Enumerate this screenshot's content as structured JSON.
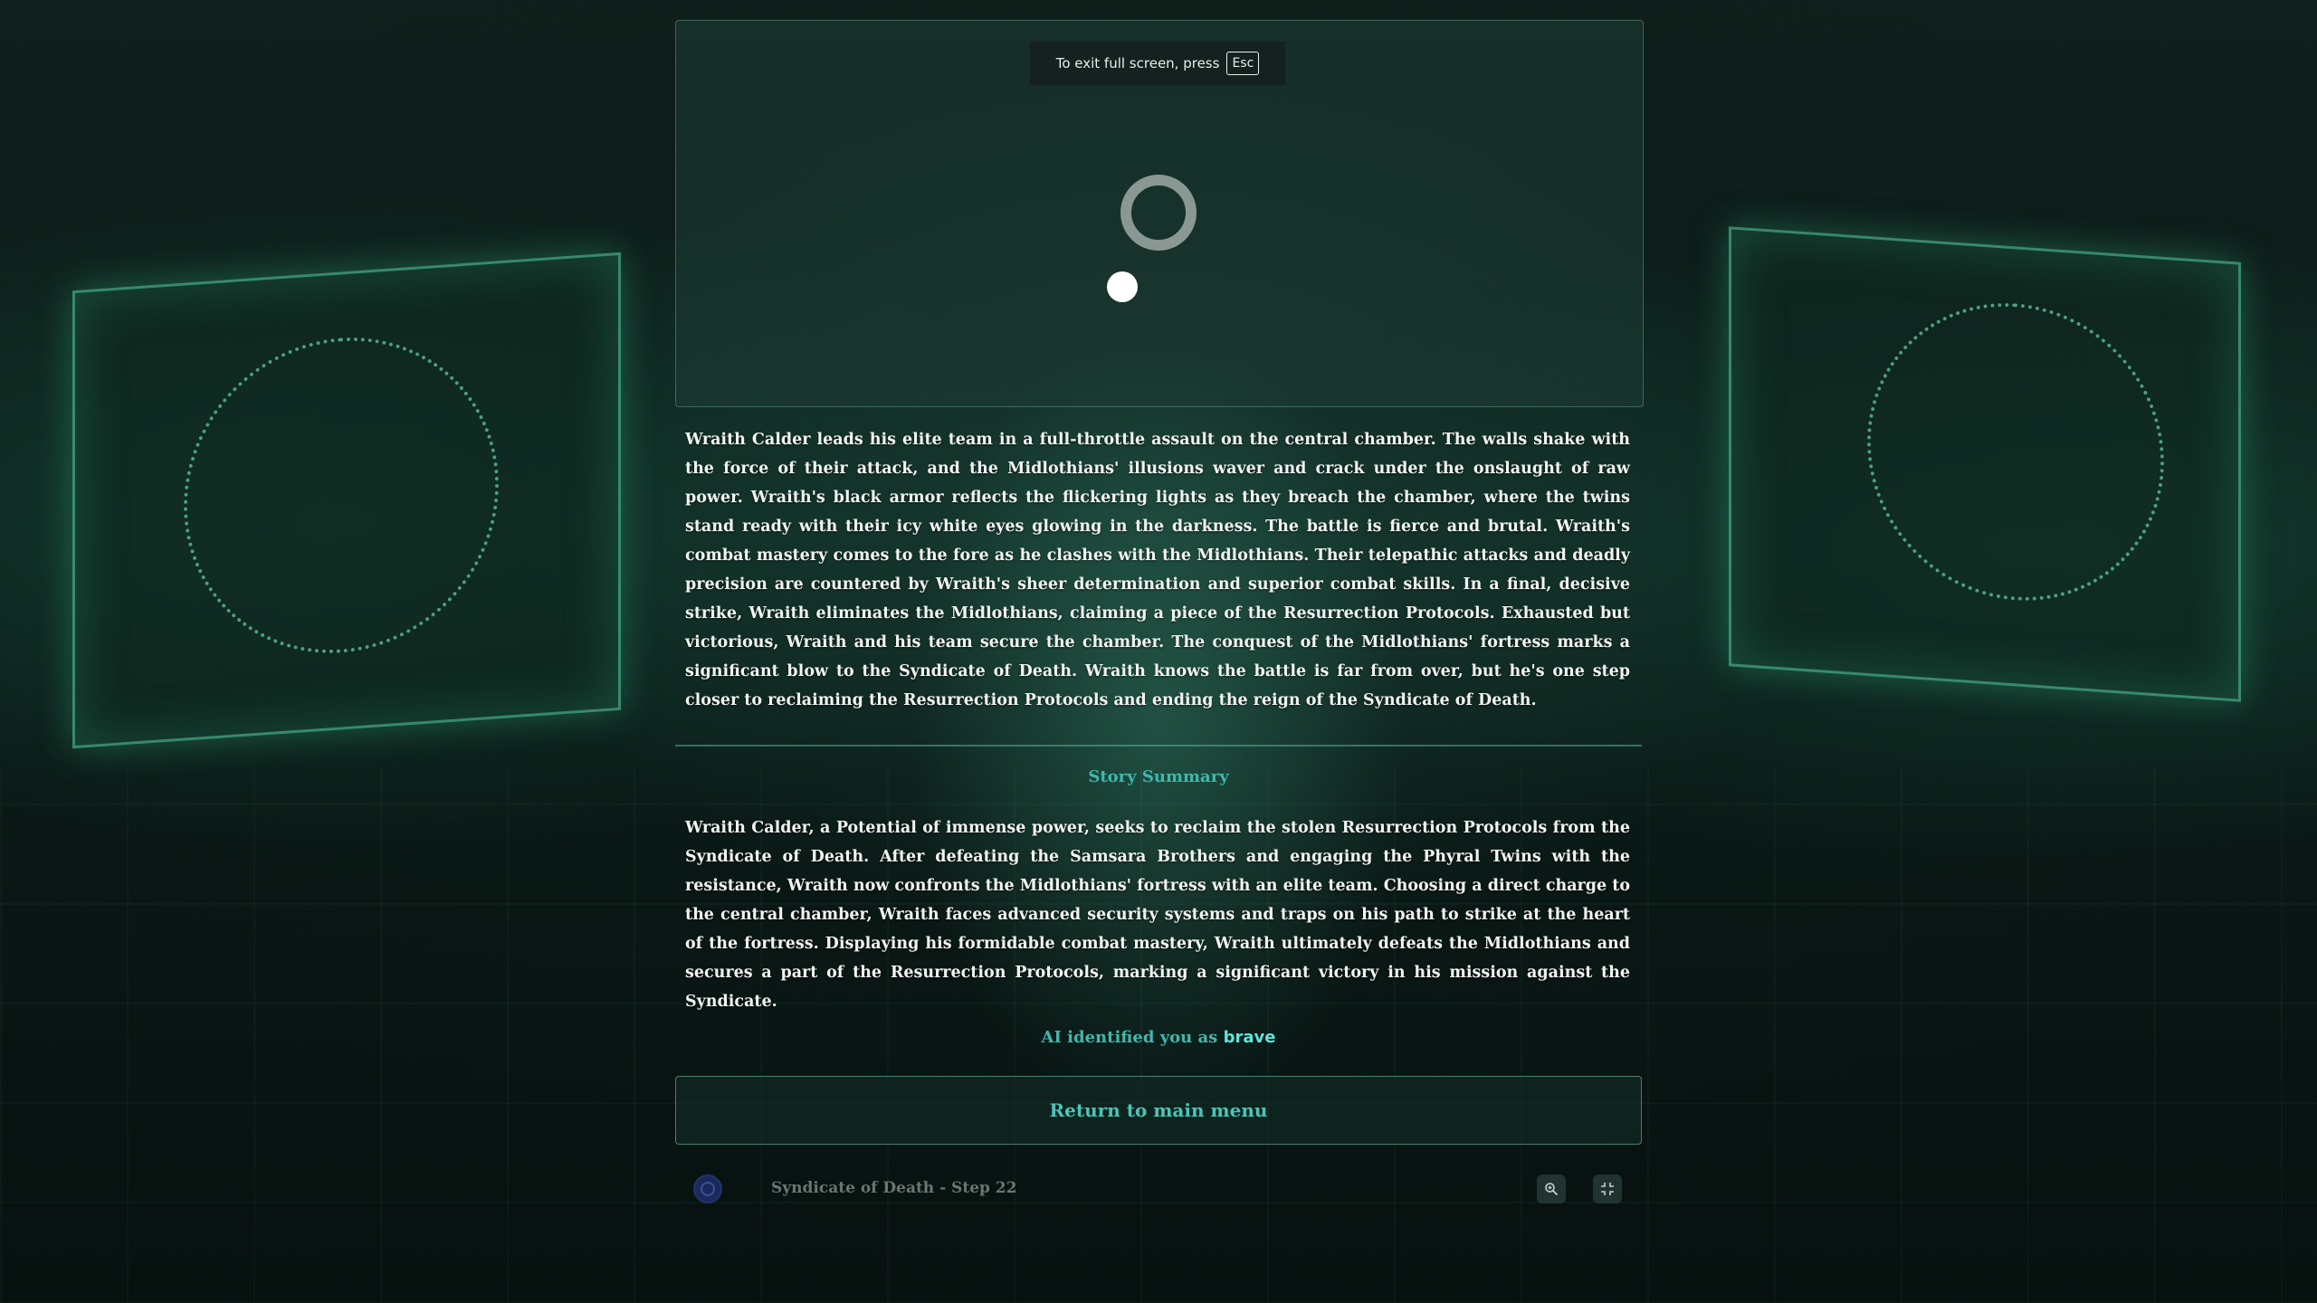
{
  "fullscreen_notice": {
    "text": "To exit full screen, press",
    "key": "Esc"
  },
  "story_text": "Wraith Calder leads his elite team in a full-throttle assault on the central chamber. The walls shake with the force of their attack, and the Midlothians' illusions waver and crack under the onslaught of raw power. Wraith's black armor reflects the flickering lights as they breach the chamber, where the twins stand ready with their icy white eyes glowing in the darkness. The battle is fierce and brutal. Wraith's combat mastery comes to the fore as he clashes with the Midlothians. Their telepathic attacks and deadly precision are countered by Wraith's sheer determination and superior combat skills. In a final, decisive strike, Wraith eliminates the Midlothians, claiming a piece of the Resurrection Protocols. Exhausted but victorious, Wraith and his team secure the chamber. The conquest of the Midlothians' fortress marks a significant blow to the Syndicate of Death. Wraith knows the battle is far from over, but he's one step closer to reclaiming the Resurrection Protocols and ending the reign of the Syndicate of Death.",
  "summary": {
    "title": "Story Summary",
    "text": "Wraith Calder, a Potential of immense power, seeks to reclaim the stolen Resurrection Protocols from the Syndicate of Death. After defeating the Samsara Brothers and engaging the Phyral Twins with the resistance, Wraith now confronts the Midlothians' fortress with an elite team. Choosing a direct charge to the central chamber, Wraith faces advanced security systems and traps on his path to strike at the heart of the fortress. Displaying his formidable combat mastery, Wraith ultimately defeats the Midlothians and secures a part of the Resurrection Protocols, marking a significant victory in his mission against the Syndicate."
  },
  "ai_identification": {
    "prefix": "AI identified you as",
    "trait": "brave"
  },
  "return_button_label": "Return to main menu",
  "footer": {
    "title": "Syndicate of Death - Step 22",
    "zoom_icon": "zoom-in-icon",
    "expand_icon": "fullscreen-exit-icon"
  },
  "colors": {
    "accent": "#3fb8ad",
    "trait": "#5fe4dc",
    "text": "#f1f3f2"
  }
}
